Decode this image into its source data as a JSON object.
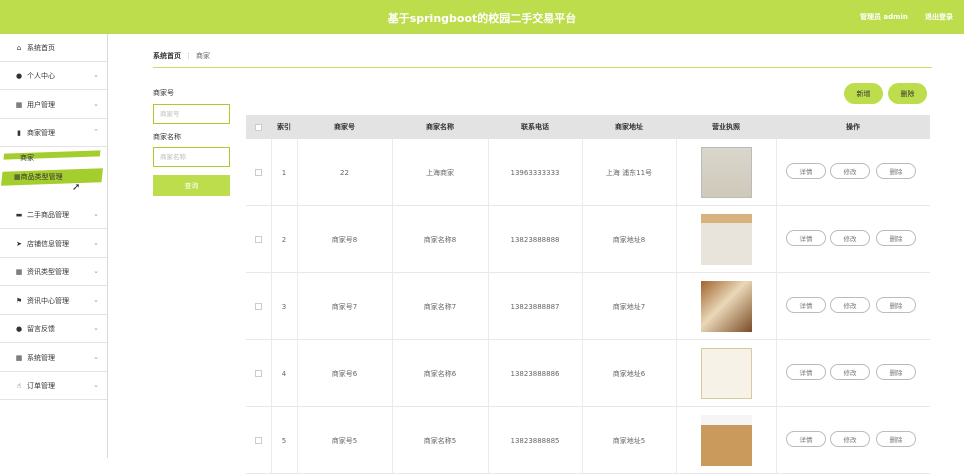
{
  "header": {
    "title": "基于springboot的校园二手交易平台",
    "user": "管理员 admin",
    "logout": "退出登录"
  },
  "sidebar": {
    "items": [
      {
        "label": "系统首页",
        "icon": "home-icon"
      },
      {
        "label": "个人中心",
        "icon": "user-icon"
      },
      {
        "label": "用户管理",
        "icon": "grid-icon"
      },
      {
        "label": "商家管理",
        "icon": "building-icon"
      },
      {
        "label": "商家",
        "icon": ""
      },
      {
        "label": "商品类型管理",
        "icon": "grid-icon"
      },
      {
        "label": "二手商品管理",
        "icon": "chat-icon"
      },
      {
        "label": "店铺信息管理",
        "icon": "send-icon"
      },
      {
        "label": "资讯类型管理",
        "icon": "grid-icon"
      },
      {
        "label": "资讯中心管理",
        "icon": "flag-icon"
      },
      {
        "label": "留言反馈",
        "icon": "person-icon"
      },
      {
        "label": "系统管理",
        "icon": "grid-icon"
      },
      {
        "label": "订单管理",
        "icon": "thumb-icon"
      }
    ]
  },
  "breadcrumb": {
    "home": "系统首页",
    "current": "商家"
  },
  "search": {
    "code_label": "商家号",
    "code_placeholder": "商家号",
    "name_label": "商家名称",
    "name_placeholder": "商家名称",
    "button": "查询"
  },
  "actions": {
    "add": "新增",
    "delete": "删除"
  },
  "table": {
    "headers": [
      "索引",
      "商家号",
      "商家名称",
      "联系电话",
      "商家地址",
      "营业执照",
      "操作"
    ],
    "rows": [
      {
        "index": "1",
        "code": "22",
        "name": "上海商家",
        "phone": "13963333333",
        "address": "上海 浦东11号"
      },
      {
        "index": "2",
        "code": "商家号8",
        "name": "商家名称8",
        "phone": "13823888888",
        "address": "商家地址8"
      },
      {
        "index": "3",
        "code": "商家号7",
        "name": "商家名称7",
        "phone": "13823888887",
        "address": "商家地址7"
      },
      {
        "index": "4",
        "code": "商家号6",
        "name": "商家名称6",
        "phone": "13823888886",
        "address": "商家地址6"
      },
      {
        "index": "5",
        "code": "商家号5",
        "name": "商家名称5",
        "phone": "13823888885",
        "address": "商家地址5"
      }
    ],
    "row_buttons": {
      "detail": "详情",
      "edit": "修改",
      "delete": "删除"
    }
  },
  "colors": {
    "accent": "#bedd4d",
    "highlight": "#a4cd2e"
  }
}
